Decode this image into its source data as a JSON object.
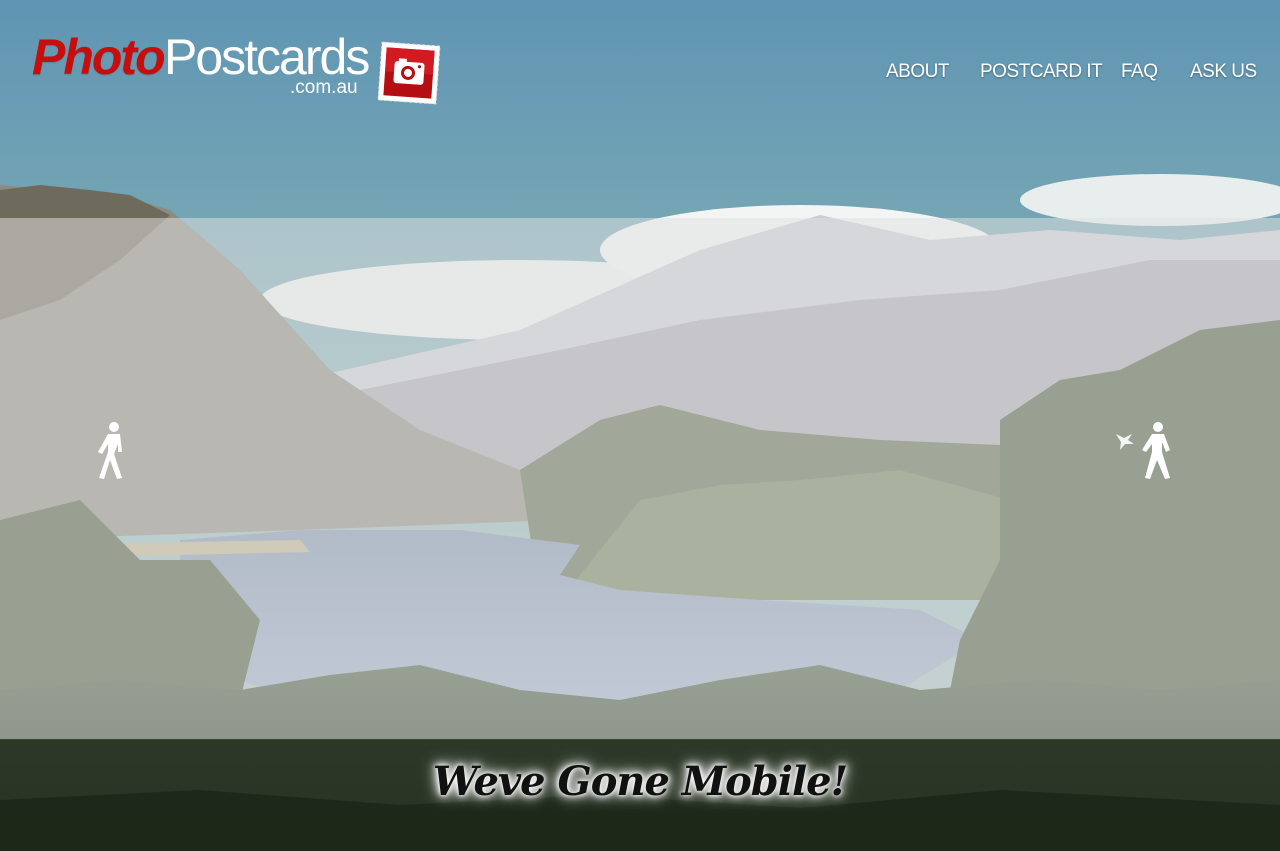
{
  "brand": {
    "word_photo": "Photo",
    "word_postcards": "Postcards",
    "domain": ".com.au",
    "stamp_icon": "camera-stamp-icon",
    "photo_color": "#c80d0d"
  },
  "nav": {
    "items": [
      {
        "label": "ABOUT"
      },
      {
        "label": "POSTCARD IT"
      },
      {
        "label": "FAQ"
      },
      {
        "label": "ASK US"
      }
    ]
  },
  "carousel": {
    "prev_icon": "walking-person-left-icon",
    "next_icon": "walking-person-right-icon"
  },
  "tagline": "Weve Gone Mobile!",
  "colors": {
    "sky_top": "#5f95b3",
    "sky_bottom": "#8fb5b3",
    "panel_overlay": "rgba(225,225,225,0.52)",
    "forest": "#2f3d2c"
  }
}
